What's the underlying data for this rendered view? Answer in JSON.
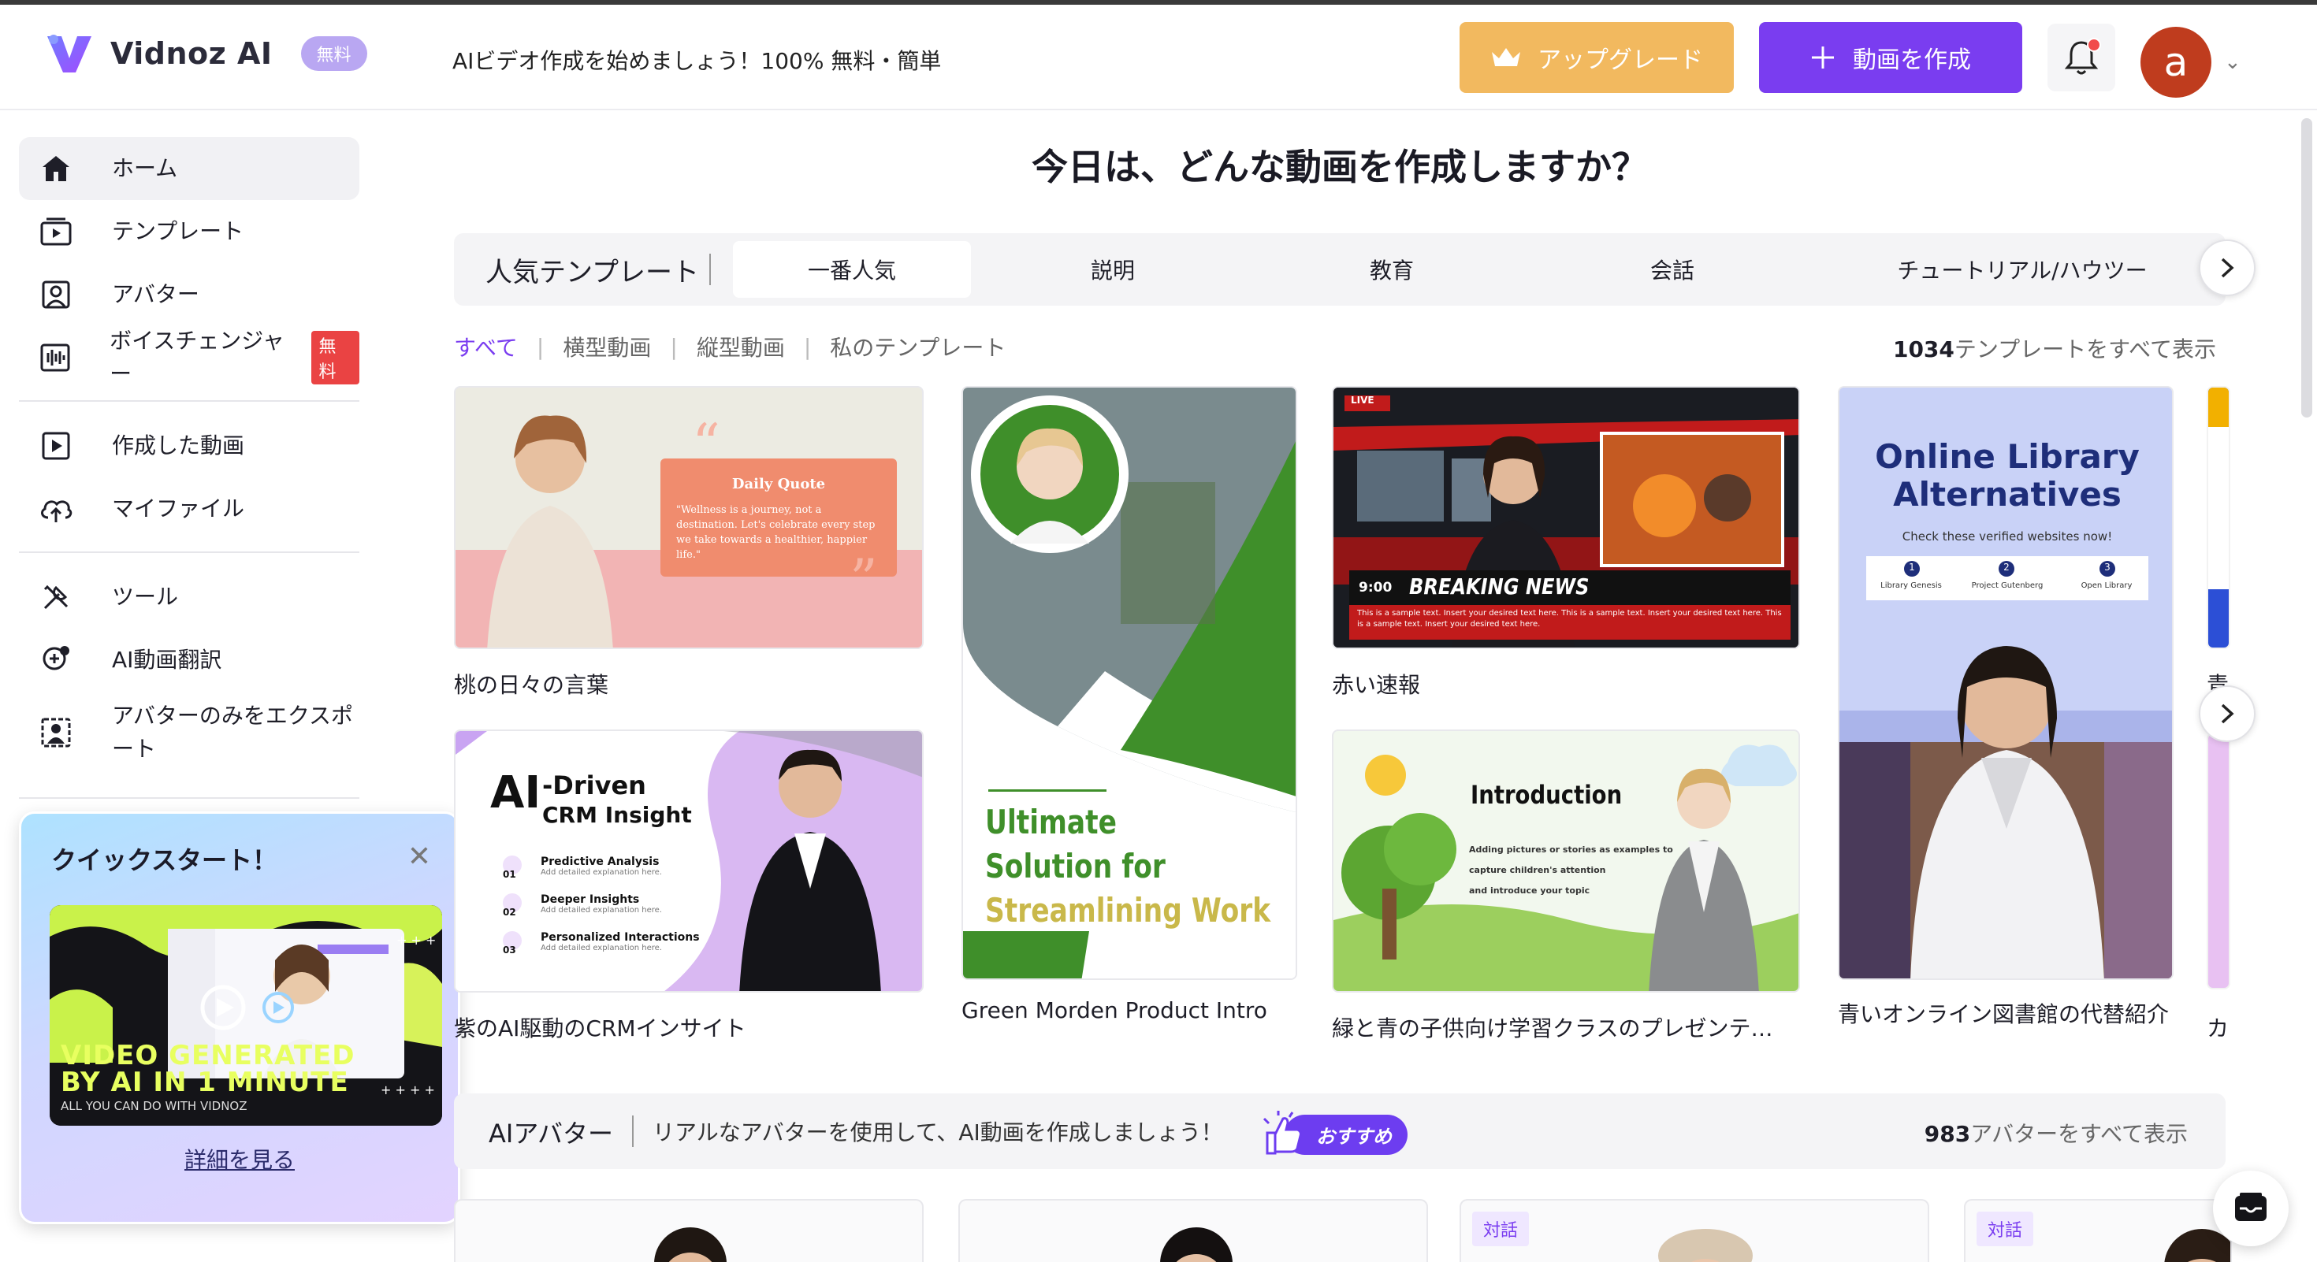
{
  "header": {
    "brand": "Vidnoz AI",
    "free_badge": "無料",
    "tagline": "AIビデオ作成を始めましょう！100% 無料・簡単",
    "upgrade_label": "アップグレード",
    "create_label": "動画を作成",
    "avatar_letter": "a"
  },
  "sidebar": {
    "items": [
      {
        "label": "ホーム",
        "icon": "home-icon"
      },
      {
        "label": "テンプレート",
        "icon": "template-icon"
      },
      {
        "label": "アバター",
        "icon": "avatar-icon"
      },
      {
        "label": "ボイスチェンジャー",
        "icon": "voice-icon",
        "badge": "無料"
      },
      {
        "label": "作成した動画",
        "icon": "video-icon"
      },
      {
        "label": "マイファイル",
        "icon": "cloud-upload-icon"
      },
      {
        "label": "ツール",
        "icon": "tools-icon"
      },
      {
        "label": "AI動画翻訳",
        "icon": "translate-icon"
      },
      {
        "label": "アバターのみをエクスポート",
        "icon": "export-avatar-icon"
      }
    ]
  },
  "quick_start": {
    "title": "クイックスタート！",
    "video_line1": "VIDEO GENERATED",
    "video_line2": "BY AI IN 1 MINUTE",
    "video_line3": "ALL YOU CAN DO WITH VIDNOZ",
    "more_link": "詳細を見る"
  },
  "main": {
    "title": "今日は、どんな動画を作成しますか？",
    "tabs_label": "人気テンプレート",
    "tabs": [
      "一番人気",
      "説明",
      "教育",
      "会話",
      "チュートリアル/ハウツー"
    ],
    "filters": [
      "すべて",
      "横型動画",
      "縦型動画",
      "私のテンプレート"
    ],
    "template_count": "1034",
    "template_show_all": "テンプレートをすべて表示"
  },
  "templates": [
    {
      "caption": "桃の日々の言葉",
      "title": "Daily Quote",
      "text": "\"Wellness is a journey, not a destination. Let's celebrate every step we take towards a healthier, happier life.\""
    },
    {
      "caption": "Green Morden Product Intro",
      "line1": "Ultimate",
      "line2": "Solution for",
      "line3": "Streamlining Work"
    },
    {
      "caption": "赤い速報",
      "live": "LIVE",
      "time": "9:00",
      "headline": "BREAKING NEWS",
      "ticker": "This is a sample text. Insert your desired text here. This is a sample text. Insert your desired text here. This is a sample text. Insert your desired text here."
    },
    {
      "caption": "青いオンライン図書館の代替紹介",
      "title1": "Online Library",
      "title2": "Alternatives",
      "subtitle": "Check these verified websites now!",
      "items": [
        "Library Genesis",
        "Project Gutenberg",
        "Open Library"
      ],
      "nums": [
        "1",
        "2",
        "3"
      ]
    },
    {
      "caption": "紫のAI駆動のCRMインサイト",
      "ai": "AI",
      "title1": "-Driven",
      "title2": "CRM Insight",
      "points": [
        {
          "num": "01",
          "title": "Predictive Analysis",
          "desc": "Add detailed explanation here."
        },
        {
          "num": "02",
          "title": "Deeper Insights",
          "desc": "Add detailed explanation here."
        },
        {
          "num": "03",
          "title": "Personalized Interactions",
          "desc": "Add detailed explanation here."
        }
      ]
    },
    {
      "caption": "緑と青の子供向け学習クラスのプレゼンテ…",
      "title": "Introduction",
      "lines": [
        "Adding pictures or stories as examples to",
        "capture children's attention",
        "and introduce your topic"
      ]
    },
    {
      "caption": "青",
      "caption2": "カ"
    }
  ],
  "avatars_section": {
    "title": "AIアバター",
    "desc": "リアルなアバターを使用して、AI動画を作成しましょう！",
    "recommend": "おすすめ",
    "count": "983",
    "show_all": "アバターをすべて表示",
    "dialog_tag": "対話"
  },
  "colors": {
    "brand_purple": "#7a3df0",
    "upgrade_orange": "#f2b95f",
    "avatar_red": "#bf3c1e"
  }
}
